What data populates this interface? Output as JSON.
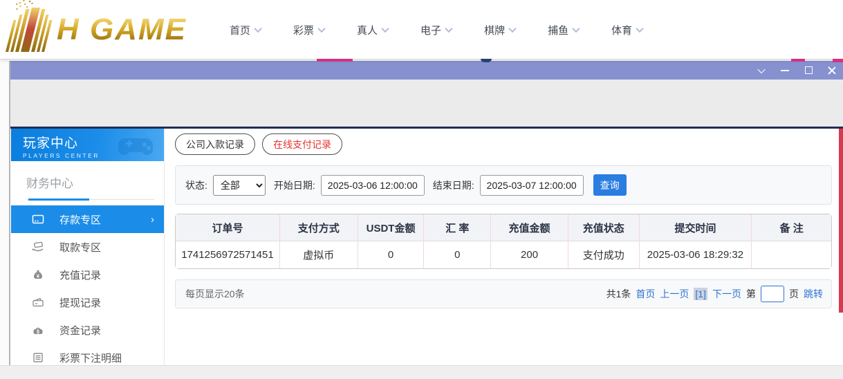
{
  "nav": {
    "logo_text": "H GAME",
    "items": [
      {
        "label": "首页"
      },
      {
        "label": "彩票"
      },
      {
        "label": "真人"
      },
      {
        "label": "电子"
      },
      {
        "label": "棋牌"
      },
      {
        "label": "捕鱼"
      },
      {
        "label": "体育"
      }
    ]
  },
  "sidebar": {
    "title": "玩家中心",
    "subtitle": "PLAYERS CENTER",
    "section_label": "财务中心",
    "items": [
      {
        "label": "存款专区",
        "icon": "deposit-card-icon",
        "active": true
      },
      {
        "label": "取款专区",
        "icon": "withdraw-hand-icon",
        "active": false
      },
      {
        "label": "充值记录",
        "icon": "money-bag-icon",
        "active": false
      },
      {
        "label": "提现记录",
        "icon": "wallet-icon",
        "active": false
      },
      {
        "label": "资金记录",
        "icon": "funds-icon",
        "active": false
      },
      {
        "label": "彩票下注明细",
        "icon": "bet-list-icon",
        "active": false
      }
    ]
  },
  "content": {
    "tabs": [
      {
        "label": "公司入款记录",
        "active": false
      },
      {
        "label": "在线支付记录",
        "active": true
      }
    ],
    "filters": {
      "status_label": "状态:",
      "status_value": "全部",
      "start_label": "开始日期:",
      "start_value": "2025-03-06 12:00:00",
      "end_label": "结束日期:",
      "end_value": "2025-03-07 12:00:00",
      "search_label": "查询"
    },
    "table": {
      "headers": [
        "订单号",
        "支付方式",
        "USDT金额",
        "汇 率",
        "充值金额",
        "充值状态",
        "提交时间",
        "备 注"
      ],
      "rows": [
        [
          "1741256972571451",
          "虚拟币",
          "0",
          "0",
          "200",
          "支付成功",
          "2025-03-06 18:29:32",
          ""
        ]
      ]
    },
    "pagination": {
      "page_size_text": "每页显示20条",
      "total_text": "共1条",
      "first_label": "首页",
      "prev_label": "上一页",
      "current_label": "[1]",
      "next_label": "下一页",
      "goto_prefix": "第",
      "goto_suffix": "页",
      "goto_label": "跳转",
      "goto_value": ""
    }
  },
  "colors": {
    "accent_blue": "#1b8ce8",
    "button_blue": "#2a7de1",
    "link_blue": "#2f74d0",
    "titlebar_purple": "#8791d0",
    "tab_red": "#e8322e",
    "logo_gold": "#d3a523",
    "table_divider_pink": "#f0d9d9",
    "right_strip_red": "#d53a4f"
  }
}
